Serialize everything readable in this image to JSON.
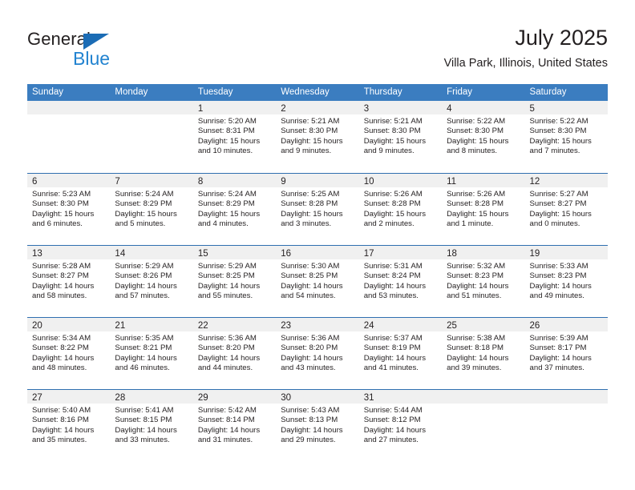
{
  "brand": {
    "name_dark": "General",
    "name_blue": "Blue",
    "triangle_color": "#1b6cb5",
    "blue_color": "#2283d0"
  },
  "header": {
    "title": "July 2025",
    "subtitle": "Villa Park, Illinois, United States"
  },
  "colors": {
    "header_blue": "#3b7dc0",
    "row_divider": "#2f6fb0",
    "day_band": "#f0f0f0",
    "text": "#231f20"
  },
  "weekdays": [
    "Sunday",
    "Monday",
    "Tuesday",
    "Wednesday",
    "Thursday",
    "Friday",
    "Saturday"
  ],
  "labels": {
    "sunrise_prefix": "Sunrise:",
    "sunset_prefix": "Sunset:",
    "daylight_prefix": "Daylight:"
  },
  "weeks": [
    [
      {
        "day": "",
        "sunrise": "",
        "sunset": "",
        "daylight_line1": "",
        "daylight_line2": ""
      },
      {
        "day": "",
        "sunrise": "",
        "sunset": "",
        "daylight_line1": "",
        "daylight_line2": ""
      },
      {
        "day": "1",
        "sunrise": "Sunrise: 5:20 AM",
        "sunset": "Sunset: 8:31 PM",
        "daylight_line1": "Daylight: 15 hours",
        "daylight_line2": "and 10 minutes."
      },
      {
        "day": "2",
        "sunrise": "Sunrise: 5:21 AM",
        "sunset": "Sunset: 8:30 PM",
        "daylight_line1": "Daylight: 15 hours",
        "daylight_line2": "and 9 minutes."
      },
      {
        "day": "3",
        "sunrise": "Sunrise: 5:21 AM",
        "sunset": "Sunset: 8:30 PM",
        "daylight_line1": "Daylight: 15 hours",
        "daylight_line2": "and 9 minutes."
      },
      {
        "day": "4",
        "sunrise": "Sunrise: 5:22 AM",
        "sunset": "Sunset: 8:30 PM",
        "daylight_line1": "Daylight: 15 hours",
        "daylight_line2": "and 8 minutes."
      },
      {
        "day": "5",
        "sunrise": "Sunrise: 5:22 AM",
        "sunset": "Sunset: 8:30 PM",
        "daylight_line1": "Daylight: 15 hours",
        "daylight_line2": "and 7 minutes."
      }
    ],
    [
      {
        "day": "6",
        "sunrise": "Sunrise: 5:23 AM",
        "sunset": "Sunset: 8:30 PM",
        "daylight_line1": "Daylight: 15 hours",
        "daylight_line2": "and 6 minutes."
      },
      {
        "day": "7",
        "sunrise": "Sunrise: 5:24 AM",
        "sunset": "Sunset: 8:29 PM",
        "daylight_line1": "Daylight: 15 hours",
        "daylight_line2": "and 5 minutes."
      },
      {
        "day": "8",
        "sunrise": "Sunrise: 5:24 AM",
        "sunset": "Sunset: 8:29 PM",
        "daylight_line1": "Daylight: 15 hours",
        "daylight_line2": "and 4 minutes."
      },
      {
        "day": "9",
        "sunrise": "Sunrise: 5:25 AM",
        "sunset": "Sunset: 8:28 PM",
        "daylight_line1": "Daylight: 15 hours",
        "daylight_line2": "and 3 minutes."
      },
      {
        "day": "10",
        "sunrise": "Sunrise: 5:26 AM",
        "sunset": "Sunset: 8:28 PM",
        "daylight_line1": "Daylight: 15 hours",
        "daylight_line2": "and 2 minutes."
      },
      {
        "day": "11",
        "sunrise": "Sunrise: 5:26 AM",
        "sunset": "Sunset: 8:28 PM",
        "daylight_line1": "Daylight: 15 hours",
        "daylight_line2": "and 1 minute."
      },
      {
        "day": "12",
        "sunrise": "Sunrise: 5:27 AM",
        "sunset": "Sunset: 8:27 PM",
        "daylight_line1": "Daylight: 15 hours",
        "daylight_line2": "and 0 minutes."
      }
    ],
    [
      {
        "day": "13",
        "sunrise": "Sunrise: 5:28 AM",
        "sunset": "Sunset: 8:27 PM",
        "daylight_line1": "Daylight: 14 hours",
        "daylight_line2": "and 58 minutes."
      },
      {
        "day": "14",
        "sunrise": "Sunrise: 5:29 AM",
        "sunset": "Sunset: 8:26 PM",
        "daylight_line1": "Daylight: 14 hours",
        "daylight_line2": "and 57 minutes."
      },
      {
        "day": "15",
        "sunrise": "Sunrise: 5:29 AM",
        "sunset": "Sunset: 8:25 PM",
        "daylight_line1": "Daylight: 14 hours",
        "daylight_line2": "and 55 minutes."
      },
      {
        "day": "16",
        "sunrise": "Sunrise: 5:30 AM",
        "sunset": "Sunset: 8:25 PM",
        "daylight_line1": "Daylight: 14 hours",
        "daylight_line2": "and 54 minutes."
      },
      {
        "day": "17",
        "sunrise": "Sunrise: 5:31 AM",
        "sunset": "Sunset: 8:24 PM",
        "daylight_line1": "Daylight: 14 hours",
        "daylight_line2": "and 53 minutes."
      },
      {
        "day": "18",
        "sunrise": "Sunrise: 5:32 AM",
        "sunset": "Sunset: 8:23 PM",
        "daylight_line1": "Daylight: 14 hours",
        "daylight_line2": "and 51 minutes."
      },
      {
        "day": "19",
        "sunrise": "Sunrise: 5:33 AM",
        "sunset": "Sunset: 8:23 PM",
        "daylight_line1": "Daylight: 14 hours",
        "daylight_line2": "and 49 minutes."
      }
    ],
    [
      {
        "day": "20",
        "sunrise": "Sunrise: 5:34 AM",
        "sunset": "Sunset: 8:22 PM",
        "daylight_line1": "Daylight: 14 hours",
        "daylight_line2": "and 48 minutes."
      },
      {
        "day": "21",
        "sunrise": "Sunrise: 5:35 AM",
        "sunset": "Sunset: 8:21 PM",
        "daylight_line1": "Daylight: 14 hours",
        "daylight_line2": "and 46 minutes."
      },
      {
        "day": "22",
        "sunrise": "Sunrise: 5:36 AM",
        "sunset": "Sunset: 8:20 PM",
        "daylight_line1": "Daylight: 14 hours",
        "daylight_line2": "and 44 minutes."
      },
      {
        "day": "23",
        "sunrise": "Sunrise: 5:36 AM",
        "sunset": "Sunset: 8:20 PM",
        "daylight_line1": "Daylight: 14 hours",
        "daylight_line2": "and 43 minutes."
      },
      {
        "day": "24",
        "sunrise": "Sunrise: 5:37 AM",
        "sunset": "Sunset: 8:19 PM",
        "daylight_line1": "Daylight: 14 hours",
        "daylight_line2": "and 41 minutes."
      },
      {
        "day": "25",
        "sunrise": "Sunrise: 5:38 AM",
        "sunset": "Sunset: 8:18 PM",
        "daylight_line1": "Daylight: 14 hours",
        "daylight_line2": "and 39 minutes."
      },
      {
        "day": "26",
        "sunrise": "Sunrise: 5:39 AM",
        "sunset": "Sunset: 8:17 PM",
        "daylight_line1": "Daylight: 14 hours",
        "daylight_line2": "and 37 minutes."
      }
    ],
    [
      {
        "day": "27",
        "sunrise": "Sunrise: 5:40 AM",
        "sunset": "Sunset: 8:16 PM",
        "daylight_line1": "Daylight: 14 hours",
        "daylight_line2": "and 35 minutes."
      },
      {
        "day": "28",
        "sunrise": "Sunrise: 5:41 AM",
        "sunset": "Sunset: 8:15 PM",
        "daylight_line1": "Daylight: 14 hours",
        "daylight_line2": "and 33 minutes."
      },
      {
        "day": "29",
        "sunrise": "Sunrise: 5:42 AM",
        "sunset": "Sunset: 8:14 PM",
        "daylight_line1": "Daylight: 14 hours",
        "daylight_line2": "and 31 minutes."
      },
      {
        "day": "30",
        "sunrise": "Sunrise: 5:43 AM",
        "sunset": "Sunset: 8:13 PM",
        "daylight_line1": "Daylight: 14 hours",
        "daylight_line2": "and 29 minutes."
      },
      {
        "day": "31",
        "sunrise": "Sunrise: 5:44 AM",
        "sunset": "Sunset: 8:12 PM",
        "daylight_line1": "Daylight: 14 hours",
        "daylight_line2": "and 27 minutes."
      },
      {
        "day": "",
        "sunrise": "",
        "sunset": "",
        "daylight_line1": "",
        "daylight_line2": ""
      },
      {
        "day": "",
        "sunrise": "",
        "sunset": "",
        "daylight_line1": "",
        "daylight_line2": ""
      }
    ]
  ]
}
